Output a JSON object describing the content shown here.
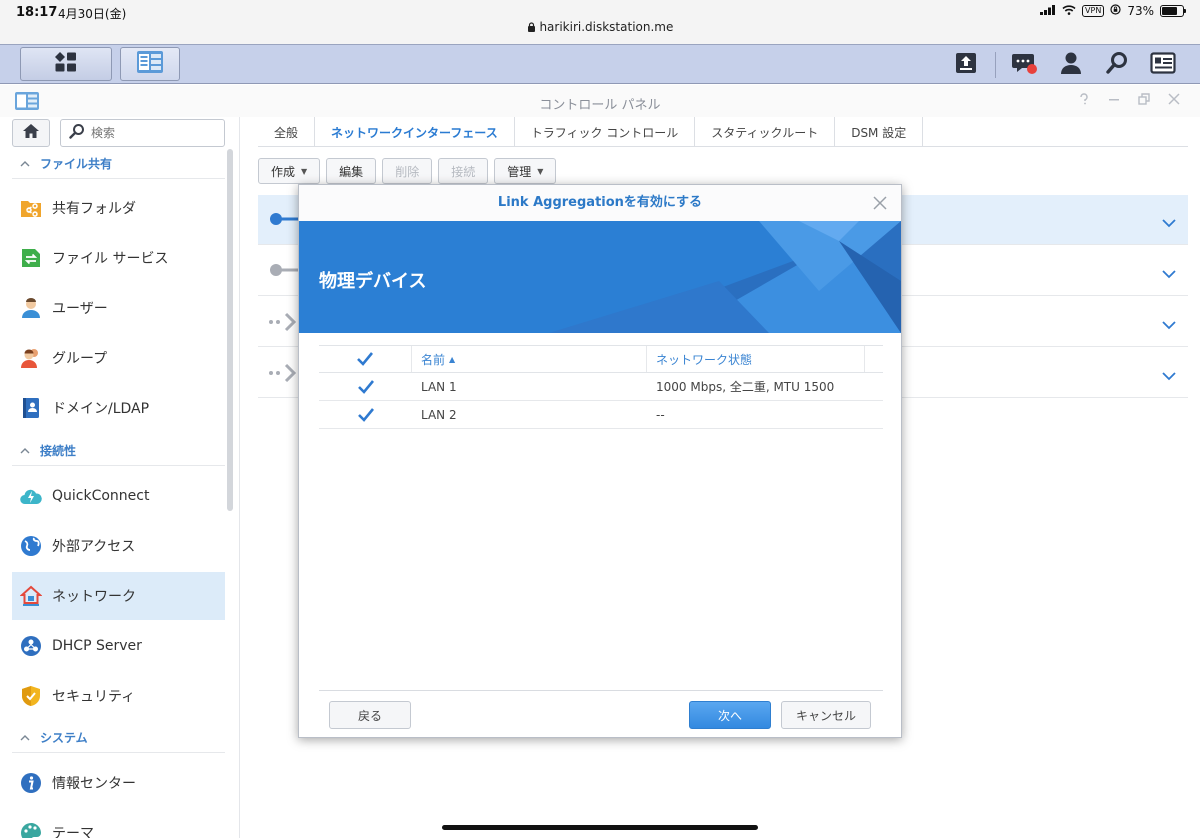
{
  "status_bar": {
    "time": "18:17",
    "date": "4月30日(金)",
    "url": "harikiri.diskstation.me",
    "vpn": "VPN",
    "battery": "73%",
    "battery_level": 0.73
  },
  "window": {
    "title": "コントロール パネル"
  },
  "sidebar": {
    "search_placeholder": "検索",
    "sections": [
      {
        "label": "ファイル共有",
        "items": [
          "共有フォルダ",
          "ファイル サービス",
          "ユーザー",
          "グループ",
          "ドメイン/LDAP"
        ]
      },
      {
        "label": "接続性",
        "items": [
          "QuickConnect",
          "外部アクセス",
          "ネットワーク",
          "DHCP Server",
          "セキュリティ"
        ]
      },
      {
        "label": "システム",
        "items": [
          "情報センター",
          "テーマ"
        ]
      }
    ],
    "active_item": "ネットワーク"
  },
  "tabs": [
    "全般",
    "ネットワークインターフェース",
    "トラフィック コントロール",
    "スタティックルート",
    "DSM 設定"
  ],
  "active_tab": "ネットワークインターフェース",
  "toolbar": {
    "create": "作成",
    "edit": "編集",
    "delete": "削除",
    "connect": "接続",
    "manage": "管理"
  },
  "dialog": {
    "title": "Link Aggregationを有効にする",
    "heading": "物理デバイス",
    "columns": {
      "name": "名前",
      "status": "ネットワーク状態"
    },
    "rows": [
      {
        "name": "LAN 1",
        "status": "1000 Mbps, 全二重, MTU 1500",
        "checked": true
      },
      {
        "name": "LAN 2",
        "status": "--",
        "checked": true
      }
    ],
    "buttons": {
      "back": "戻る",
      "next": "次へ",
      "cancel": "キャンセル"
    }
  },
  "colors": {
    "accent": "#2a7bd2",
    "banner": "#2b7fd4",
    "topbar": "#c6d0ea"
  }
}
